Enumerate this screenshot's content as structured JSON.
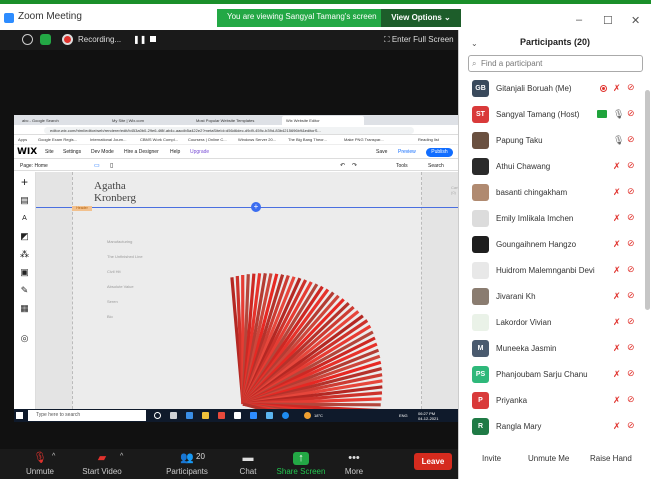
{
  "window": {
    "title": "Zoom Meeting",
    "banner": "You are viewing Sangyal Tamang's screen",
    "view_options": "View Options ⌄",
    "min": "–",
    "max": "☐",
    "close": "✕"
  },
  "meeting_bar": {
    "recording": "Recording...",
    "pause": "❚❚",
    "fullscreen": "⛶ Enter Full Screen"
  },
  "browser": {
    "tabs": [
      "abc - Google Search",
      "My Site | Wix.com",
      "Most Popular Website Templates",
      "Wix Website Editor"
    ],
    "url": "editor.wix.com/html/editor/web/renderer/edit/b453a0b0-29e6-4f8f-ab4c-aacdb5a422e2?metaSiteId=d56d6dec-d9d9-459c-b39d-83b4215696b9&editorS...",
    "bookmarks": [
      "Apps",
      "Google Exam Regis...",
      "International Journ...",
      "CBMS Work Compl...",
      "Coursera | Online C...",
      "Windows Server 20...",
      "The Big Bang Theor...",
      "Make PNG Transpar...",
      "Reading list"
    ]
  },
  "wix": {
    "logo": "WIX",
    "menu": [
      "Site",
      "Settings",
      "Dev Mode",
      "Hire a Designer",
      "Help",
      "Upgrade"
    ],
    "save": "Save",
    "preview": "Preview",
    "publish": "Publish",
    "page_label": "Page: Home",
    "tools": "Tools",
    "search": "Search",
    "site_title_1": "Agatha",
    "site_title_2": "Kronberg",
    "header_tag": "Header",
    "site_menu": [
      "Manufacturing",
      "The Unfinished Line",
      "Civil Hit",
      "Absolute Value",
      "Seren",
      "Bio"
    ],
    "cart": "Cart (0)"
  },
  "taskbar": {
    "search_placeholder": "Type here to search",
    "weather": "18°C",
    "time": "06:27 PM",
    "date": "04-12-2021",
    "lang": "ENG"
  },
  "toolbar": {
    "unmute": "Unmute",
    "start_video": "Start Video",
    "participants": "Participants",
    "participants_count": "20",
    "chat": "Chat",
    "share_screen": "Share Screen",
    "more": "More",
    "leave": "Leave"
  },
  "panel": {
    "title": "Participants (20)",
    "search_placeholder": "Find a participant",
    "participants": [
      {
        "name": "Gitanjali Boruah (Me)",
        "initials": "GB",
        "color": "#3a4a5c"
      },
      {
        "name": "Sangyal Tamang (Host)",
        "initials": "ST",
        "color": "#d93a3a"
      },
      {
        "name": "Papung Taku",
        "initials": "",
        "color": "#6a5040"
      },
      {
        "name": "Athui Chawang",
        "initials": "",
        "color": "#2a2a2a"
      },
      {
        "name": "basanti chingakham",
        "initials": "",
        "color": "#b08a70"
      },
      {
        "name": "Emily Imlikala Imchen",
        "initials": "",
        "color": "#dcdcdc"
      },
      {
        "name": "Goungaihnem Hangzo",
        "initials": "",
        "color": "#1e1e1e"
      },
      {
        "name": "Huidrom Malemnganbi  Devi",
        "initials": "",
        "color": "#e8e8e8"
      },
      {
        "name": "Jivarani Kh",
        "initials": "",
        "color": "#8a7c70"
      },
      {
        "name": "Lakordor Vivian",
        "initials": "",
        "color": "#eaf2e8"
      },
      {
        "name": "Muneeka Jasmin",
        "initials": "M",
        "color": "#4a5a6e"
      },
      {
        "name": "Phanjoubam Sarju Chanu",
        "initials": "PS",
        "color": "#2eb87a"
      },
      {
        "name": "Priyanka",
        "initials": "P",
        "color": "#d93a3a"
      },
      {
        "name": "Rangla Mary",
        "initials": "R",
        "color": "#1f7a45"
      }
    ],
    "invite": "Invite",
    "unmute_me": "Unmute Me",
    "raise_hand": "Raise Hand"
  }
}
